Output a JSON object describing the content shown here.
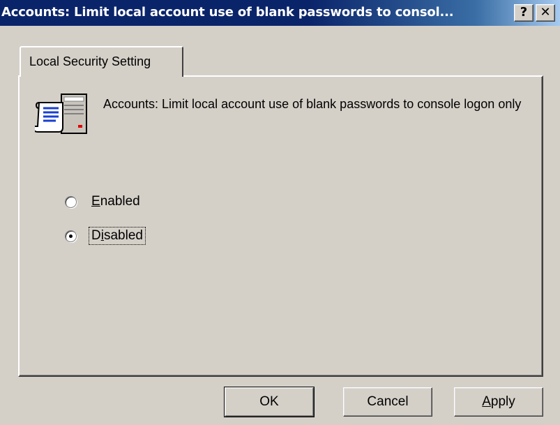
{
  "window": {
    "title": "Accounts: Limit local account use of blank passwords to consol...",
    "help_button": "?",
    "close_button": "✕"
  },
  "tabs": [
    {
      "label": "Local Security Setting",
      "active": true
    }
  ],
  "policy": {
    "icon": "security-policy-icon",
    "description": "Accounts: Limit local account use of blank passwords to console logon only"
  },
  "options": {
    "enabled": {
      "label_access": "E",
      "label_rest": "nabled",
      "selected": false
    },
    "disabled": {
      "label_pre": "D",
      "label_access": "i",
      "label_rest": "sabled",
      "selected": true
    }
  },
  "buttons": {
    "ok": "OK",
    "cancel": "Cancel",
    "apply_access": "A",
    "apply_rest": "pply"
  },
  "colors": {
    "titlebar_start": "#0a246a",
    "titlebar_end": "#a6caf0",
    "face": "#d4d0c8"
  }
}
